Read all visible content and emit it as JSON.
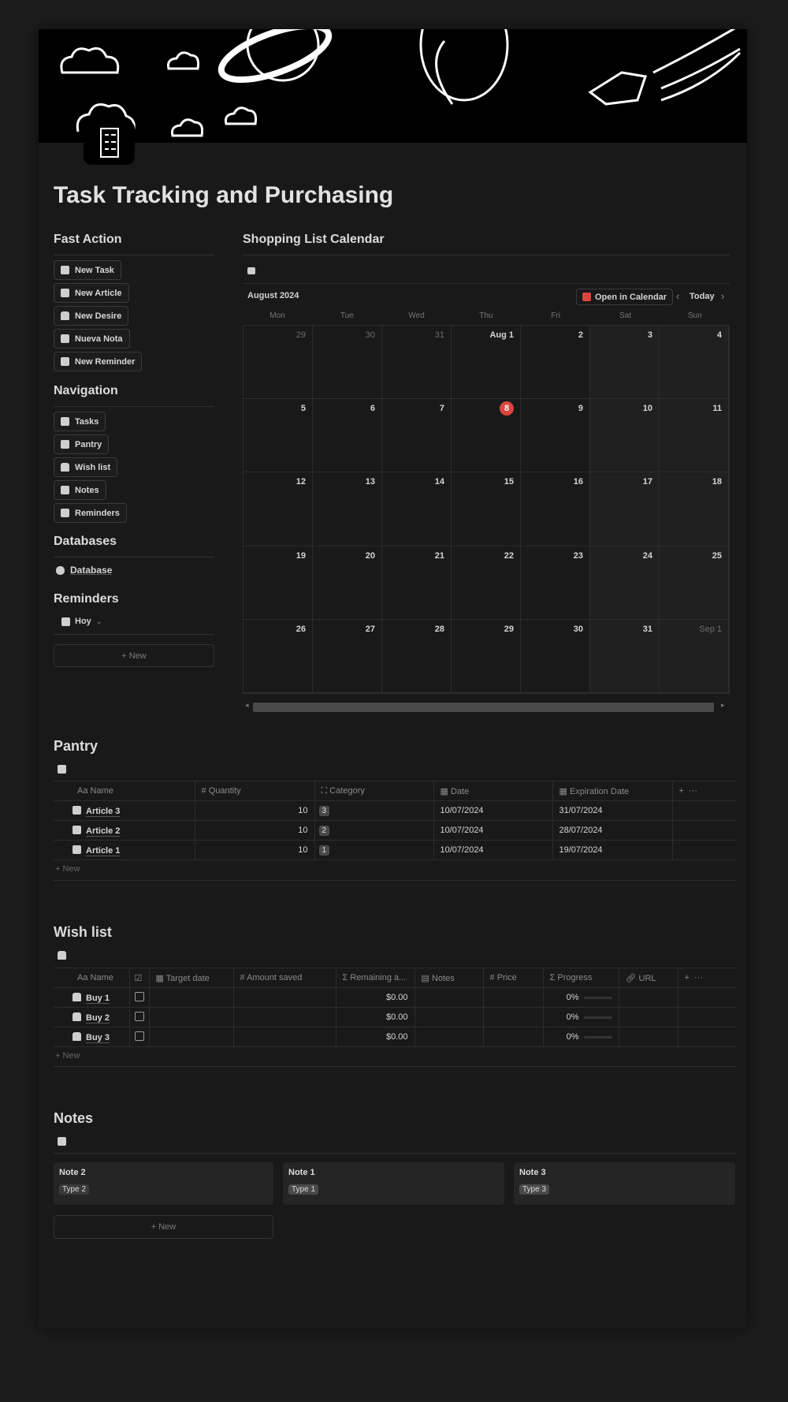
{
  "title": "Task Tracking and Purchasing",
  "fast_action": {
    "heading": "Fast Action",
    "buttons": [
      {
        "label": "New Task",
        "icon": "checkbox-icon"
      },
      {
        "label": "New Article",
        "icon": "box-icon"
      },
      {
        "label": "New Desire",
        "icon": "bag-icon"
      },
      {
        "label": "Nueva Nota",
        "icon": "note-icon"
      },
      {
        "label": "New Reminder",
        "icon": "bell-icon"
      }
    ]
  },
  "navigation": {
    "heading": "Navigation",
    "buttons": [
      {
        "label": "Tasks",
        "icon": "checkbox-icon"
      },
      {
        "label": "Pantry",
        "icon": "box-icon"
      },
      {
        "label": "Wish list",
        "icon": "bag-icon"
      },
      {
        "label": "Notes",
        "icon": "note-icon"
      },
      {
        "label": "Reminders",
        "icon": "bell-icon"
      }
    ]
  },
  "databases": {
    "heading": "Databases",
    "link": "Database"
  },
  "reminders": {
    "heading": "Reminders",
    "view": "Hoy",
    "new": "New"
  },
  "calendar": {
    "heading": "Shopping List Calendar",
    "month": "August 2024",
    "open_btn": "Open in Calendar",
    "today_btn": "Today",
    "accent": "#d9463f",
    "weekdays": [
      "Mon",
      "Tue",
      "Wed",
      "Thu",
      "Fri",
      "Sat",
      "Sun"
    ],
    "days": [
      "29",
      "30",
      "31",
      "Aug 1",
      "2",
      "3",
      "4",
      "5",
      "6",
      "7",
      "8",
      "9",
      "10",
      "11",
      "12",
      "13",
      "14",
      "15",
      "16",
      "17",
      "18",
      "19",
      "20",
      "21",
      "22",
      "23",
      "24",
      "25",
      "26",
      "27",
      "28",
      "29",
      "30",
      "31",
      "Sep 1"
    ]
  },
  "pantry": {
    "heading": "Pantry",
    "columns": [
      "Name",
      "Quantity",
      "Category",
      "Date",
      "Expiration Date"
    ],
    "rows": [
      {
        "name": "Article 3",
        "qty": "10",
        "cat": "3",
        "date": "10/07/2024",
        "exp": "31/07/2024"
      },
      {
        "name": "Article 2",
        "qty": "10",
        "cat": "2",
        "date": "10/07/2024",
        "exp": "28/07/2024"
      },
      {
        "name": "Article 1",
        "qty": "10",
        "cat": "1",
        "date": "10/07/2024",
        "exp": "19/07/2024"
      }
    ],
    "new": "New"
  },
  "wishlist": {
    "heading": "Wish list",
    "columns": [
      "Name",
      "Target date",
      "Amount saved",
      "Remaining a...",
      "Notes",
      "Price",
      "Progress",
      "URL"
    ],
    "rows": [
      {
        "name": "Buy 1",
        "remaining": "$0.00",
        "progress": "0%"
      },
      {
        "name": "Buy 2",
        "remaining": "$0.00",
        "progress": "0%"
      },
      {
        "name": "Buy 3",
        "remaining": "$0.00",
        "progress": "0%"
      }
    ],
    "new": "New"
  },
  "notes": {
    "heading": "Notes",
    "cards": [
      {
        "title": "Note 2",
        "type": "Type 2"
      },
      {
        "title": "Note 1",
        "type": "Type 1"
      },
      {
        "title": "Note 3",
        "type": "Type 3"
      }
    ],
    "new": "New"
  }
}
